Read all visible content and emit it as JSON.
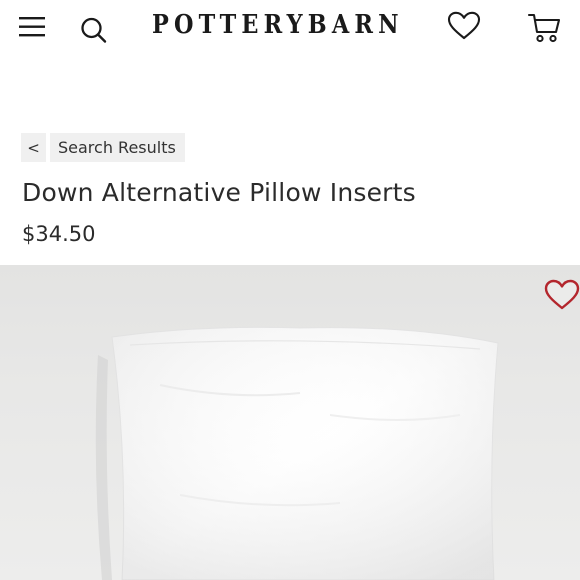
{
  "header": {
    "logo_text": "POTTERYBARN",
    "icons": {
      "menu": "hamburger-menu-icon",
      "search": "search-icon",
      "wishlist": "heart-icon",
      "cart": "shopping-cart-icon"
    }
  },
  "breadcrumb": {
    "back_label": "<",
    "link_label": "Search Results"
  },
  "product": {
    "title": "Down Alternative Pillow Inserts",
    "price": "$34.50",
    "favorite_icon": "heart-outline-icon",
    "favorite_color": "#b3262d",
    "image_subject": "white square pillow insert"
  },
  "colors": {
    "text": "#222222",
    "breadcrumb_bg": "#f0f0f0",
    "image_bg": "#e6e6e5"
  }
}
